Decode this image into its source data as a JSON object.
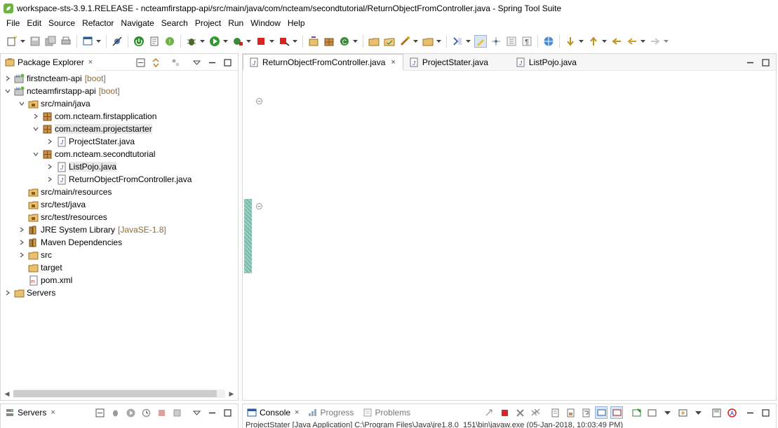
{
  "window": {
    "title": "workspace-sts-3.9.1.RELEASE - ncteamfirstapp-api/src/main/java/com/ncteam/secondtutorial/ReturnObjectFromController.java - Spring Tool Suite"
  },
  "menu": [
    "File",
    "Edit",
    "Source",
    "Refactor",
    "Navigate",
    "Search",
    "Project",
    "Run",
    "Window",
    "Help"
  ],
  "package_explorer": {
    "title": "Package Explorer",
    "close": "×",
    "tree": [
      {
        "label": "firstncteam-api",
        "deco": "[boot]"
      },
      {
        "label": "ncteamfirstapp-api",
        "deco": "[boot]"
      },
      {
        "label": "src/main/java",
        "deco": ""
      },
      {
        "label": "com.ncteam.firstapplication",
        "deco": ""
      },
      {
        "label": "com.ncteam.projectstarter",
        "deco": ""
      },
      {
        "label": "ProjectStater.java",
        "deco": ""
      },
      {
        "label": "com.ncteam.secondtutorial",
        "deco": ""
      },
      {
        "label": "ListPojo.java",
        "deco": ""
      },
      {
        "label": "ReturnObjectFromController.java",
        "deco": ""
      },
      {
        "label": "src/main/resources",
        "deco": ""
      },
      {
        "label": "src/test/java",
        "deco": ""
      },
      {
        "label": "src/test/resources",
        "deco": ""
      },
      {
        "label": "JRE System Library",
        "deco": "[JavaSE-1.8]"
      },
      {
        "label": "Maven Dependencies",
        "deco": ""
      },
      {
        "label": "src",
        "deco": ""
      },
      {
        "label": "target",
        "deco": ""
      },
      {
        "label": "pom.xml",
        "deco": ""
      },
      {
        "label": "Servers",
        "deco": ""
      }
    ]
  },
  "editor": {
    "tabs": [
      {
        "label": "ReturnObjectFromController.java",
        "close": "×"
      },
      {
        "label": "ProjectStater.java"
      },
      {
        "label": "ListPojo.java"
      }
    ]
  },
  "servers_view": {
    "title": "Servers",
    "close": "×"
  },
  "console_view": {
    "tabs": [
      {
        "label": "Console",
        "close": "×"
      },
      {
        "label": "Progress"
      },
      {
        "label": "Problems"
      }
    ],
    "line": "ProjectStater [Java Application] C:\\Program Files\\Java\\jre1.8.0_151\\bin\\javaw.exe (05-Jan-2018, 10:03:49 PM)"
  },
  "colors": {
    "keyword": "#7f0055",
    "string": "#2a00ff",
    "annotation": "#646464",
    "change_bar": "#7ab8a9",
    "spring_green": "#6db33f"
  }
}
